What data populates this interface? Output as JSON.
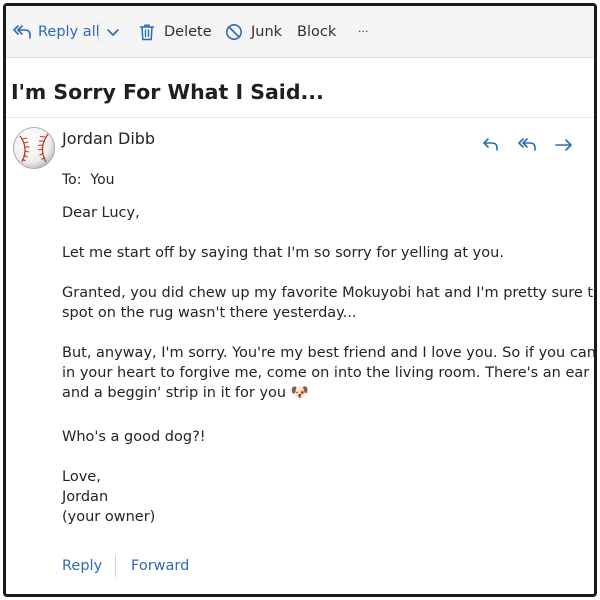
{
  "toolbar": {
    "reply_all_label": "Reply all",
    "delete_label": "Delete",
    "junk_label": "Junk",
    "block_label": "Block",
    "more_label": "···"
  },
  "email": {
    "subject": "I'm Sorry For What I Said...",
    "sender_name": "Jordan Dibb",
    "to_prefix": "To:",
    "to_value": "You",
    "body_lines": [
      "Dear Lucy,",
      "Let me start off by saying that I'm so sorry for yelling at you.",
      "Granted, you did chew up my favorite Mokuyobi hat and I'm pretty sure that",
      "spot on the rug wasn't there yesterday...",
      "But, anyway, I'm sorry. You're my best friend and I love you. So if you can find it",
      "in your heart to forgive me, come on into the living room. There's an ear scratch",
      "and a beggin' strip in it for you 🐶",
      "Who's a good dog?!",
      "Love,",
      "Jordan",
      "(your owner)"
    ]
  },
  "footer": {
    "reply_label": "Reply",
    "forward_label": "Forward"
  },
  "icons": {
    "reply_all": "reply-all-icon",
    "dropdown": "chevron-down-icon",
    "delete": "trash-icon",
    "junk": "block-circle-icon",
    "reply": "reply-icon",
    "forward": "forward-icon",
    "avatar": "baseball-icon"
  },
  "colors": {
    "accent": "#2b6cb0",
    "toolbar_bg": "#f5f5f5",
    "text": "#242424"
  }
}
